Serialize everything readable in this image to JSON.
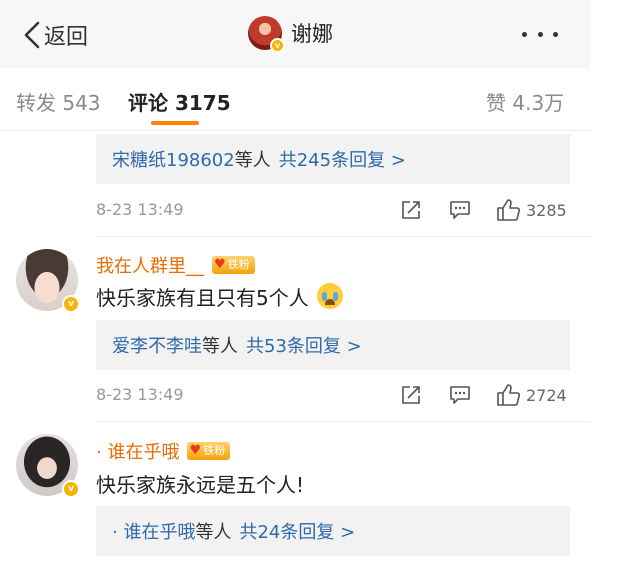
{
  "header": {
    "back_label": "返回",
    "title": "谢娜",
    "more_icon": "more-horizontal-icon",
    "verified_color": "#f7b500"
  },
  "tabs": {
    "repost": "转发 543",
    "comments": "评论 3175",
    "likes": "赞 4.3万",
    "active": "comments",
    "accent": "#ff8200"
  },
  "comments": [
    {
      "reply_summary": {
        "names": "宋糖纸198602",
        "suffix": "等人",
        "link": "共245条回复 >"
      },
      "time": "8-23 13:49",
      "likes": "3285"
    },
    {
      "username": "我在人群里__",
      "fan_badge": "铁粉",
      "text": "快乐家族有且只有5个人",
      "emoji": "crying-face-emoji",
      "reply_summary": {
        "names": "爱李不李哇",
        "suffix": "等人",
        "link": "共53条回复 >"
      },
      "time": "8-23 13:49",
      "likes": "2724"
    },
    {
      "username": "· 谁在乎哦",
      "fan_badge": "铁粉",
      "text": "快乐家族永远是五个人!",
      "reply_summary": {
        "names": "· 谁在乎哦",
        "suffix": "等人",
        "link": "共24条回复 >"
      }
    }
  ],
  "colors": {
    "username": "#e86d00",
    "link": "#2f6aa8",
    "reply_box_bg": "#f2f2f2",
    "meta_text": "#999999"
  }
}
